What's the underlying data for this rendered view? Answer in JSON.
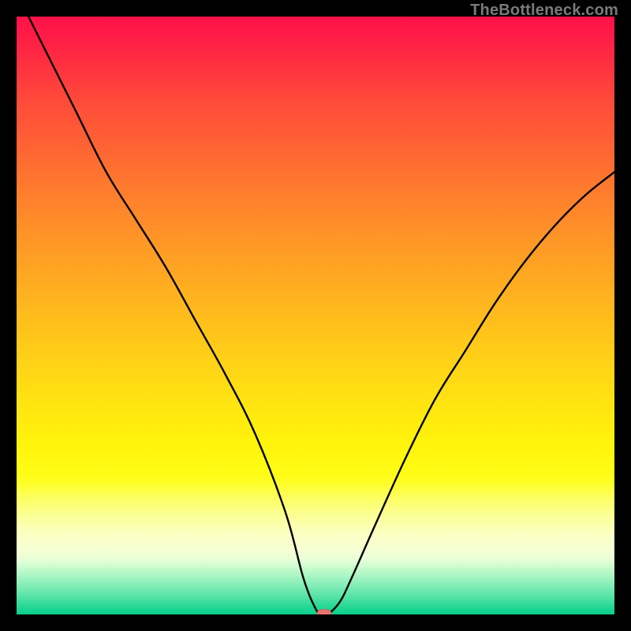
{
  "watermark": "TheBottleneck.com",
  "chart_data": {
    "type": "line",
    "title": "",
    "xlabel": "",
    "ylabel": "",
    "xlim": [
      0,
      100
    ],
    "ylim": [
      0,
      100
    ],
    "grid": false,
    "legend": false,
    "background_gradient": "vertical red-to-green",
    "series": [
      {
        "name": "bottleneck-curve",
        "x": [
          2,
          5,
          10,
          15,
          20,
          25,
          30,
          35,
          40,
          45,
          48,
          50,
          51,
          52,
          54,
          56,
          60,
          65,
          70,
          75,
          80,
          85,
          90,
          95,
          100
        ],
        "values": [
          100,
          94,
          84,
          74,
          66,
          58,
          49,
          40,
          30,
          17,
          6,
          1,
          0,
          0,
          2,
          6,
          15,
          26,
          36,
          44,
          52,
          59,
          65,
          70,
          74
        ]
      }
    ],
    "marker": {
      "x": 51.5,
      "y": 0,
      "color": "#ed7a74"
    },
    "colors": {
      "top": "#ff1249",
      "mid": "#ffcc18",
      "bottom": "#06d08a",
      "curve": "#000000",
      "marker": "#ed7a74"
    }
  }
}
